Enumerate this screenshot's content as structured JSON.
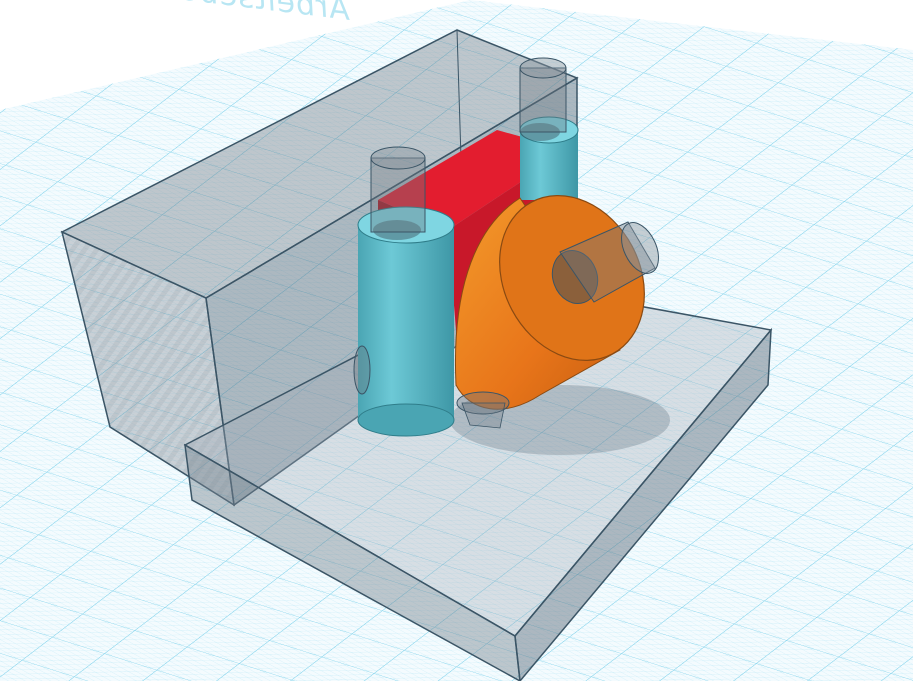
{
  "workplane": {
    "label": "Arbeitsebene",
    "grid_color": "#6ed0ee",
    "background_color": "#ffffff"
  },
  "scene": {
    "shapes": [
      {
        "name": "back-hole-box",
        "kind": "box",
        "style": "hole"
      },
      {
        "name": "front-hole-slab",
        "kind": "box",
        "style": "hole"
      },
      {
        "name": "red-box",
        "kind": "box",
        "color": "#e31d2f"
      },
      {
        "name": "blue-cylinder-left",
        "kind": "cylinder",
        "color": "#5fbfcc"
      },
      {
        "name": "blue-cylinder-right",
        "kind": "cylinder",
        "color": "#5fbfcc"
      },
      {
        "name": "orange-cone",
        "kind": "cone",
        "color": "#e8751a"
      },
      {
        "name": "hole-cylinders",
        "kind": "cylinder",
        "style": "hole"
      }
    ]
  }
}
